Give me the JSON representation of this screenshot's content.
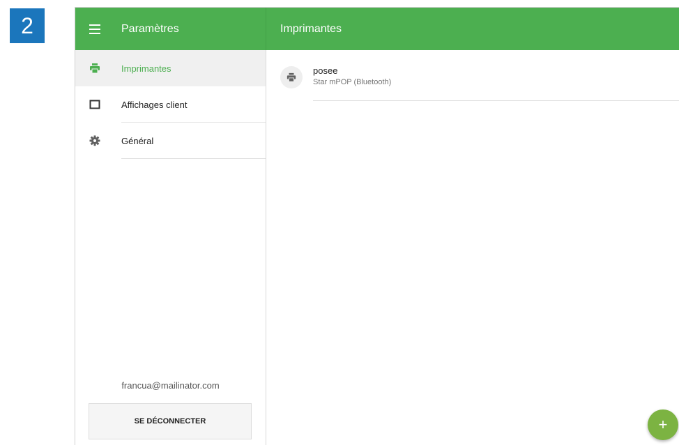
{
  "step_badge": "2",
  "topbar": {
    "app_title": "Paramètres",
    "section_title": "Imprimantes",
    "color": "#4caf50"
  },
  "sidebar": {
    "items": [
      {
        "label": "Imprimantes",
        "icon": "printer-icon",
        "active": true
      },
      {
        "label": "Affichages client",
        "icon": "display-icon",
        "active": false
      },
      {
        "label": "Général",
        "icon": "gear-icon",
        "active": false
      }
    ],
    "email": "francua@mailinator.com",
    "logout_label": "SE DÉCONNECTER"
  },
  "printers": [
    {
      "name": "posee",
      "model": "Star mPOP (Bluetooth)",
      "icon": "printer-icon"
    }
  ],
  "fab": {
    "label": "+",
    "icon": "plus-icon"
  }
}
